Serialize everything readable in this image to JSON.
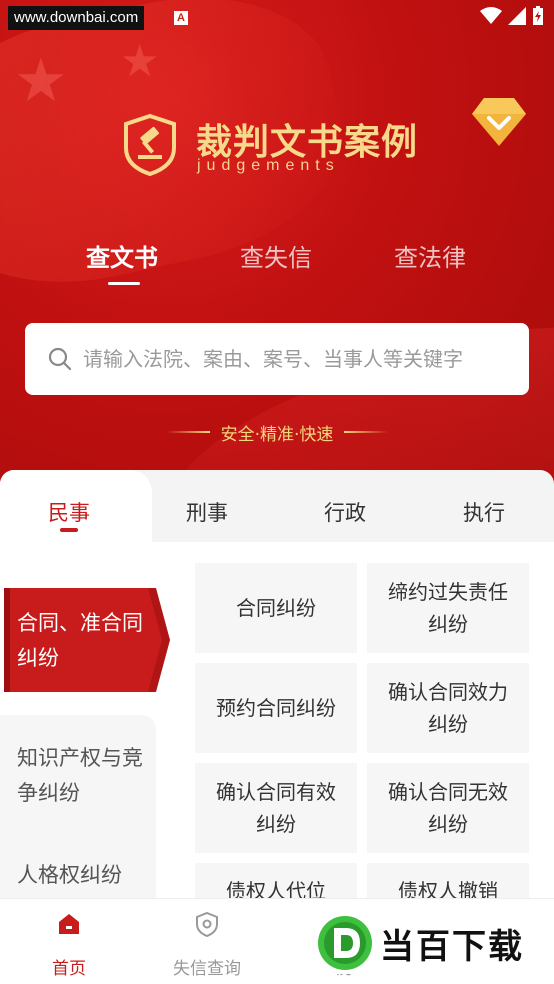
{
  "status": {
    "watermark": "www.downbai.com",
    "badge": "A"
  },
  "header": {
    "title": "裁判文书案例",
    "subtitle": "judgements",
    "vip_icon": "diamond-chevron-icon"
  },
  "top_tabs": [
    {
      "label": "查文书",
      "active": true
    },
    {
      "label": "查失信",
      "active": false
    },
    {
      "label": "查法律",
      "active": false
    }
  ],
  "search": {
    "placeholder": "请输入法院、案由、案号、当事人等关键字"
  },
  "slogan": "安全·精准·快速",
  "categories": [
    {
      "label": "民事",
      "active": true
    },
    {
      "label": "刑事",
      "active": false
    },
    {
      "label": "行政",
      "active": false
    },
    {
      "label": "执行",
      "active": false
    }
  ],
  "side_menu": [
    {
      "label": "合同、准合同纠纷",
      "active": true
    },
    {
      "label": "知识产权与竞争纠纷",
      "active": false
    },
    {
      "label": "人格权纠纷",
      "active": false
    }
  ],
  "grid": [
    "合同纠纷",
    "缔约过失责任纠纷",
    "预约合同纠纷",
    "确认合同效力纠纷",
    "确认合同有效纠纷",
    "确认合同无效纠纷",
    "债权人代位",
    "债权人撤销"
  ],
  "bottom_nav": [
    {
      "label": "首页",
      "icon": "home-icon",
      "active": true
    },
    {
      "label": "失信查询",
      "icon": "shield-icon",
      "active": false
    },
    {
      "label": "历",
      "icon": "history-icon",
      "active": false
    }
  ],
  "brand_watermark": "当百下载",
  "colors": {
    "primary_red": "#c81b1b",
    "gold": "#f6d98a",
    "header_red": "#c01010"
  }
}
